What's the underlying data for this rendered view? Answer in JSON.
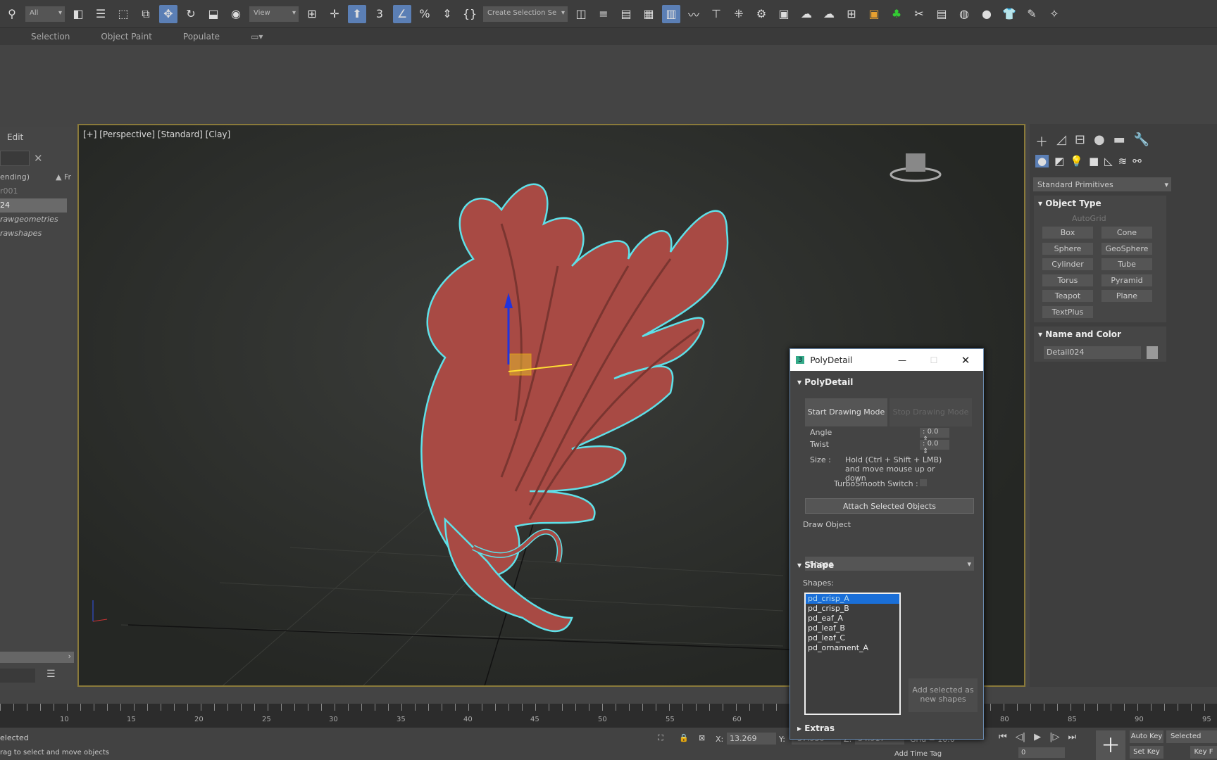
{
  "toolbar": {
    "selection_filter": "All",
    "ref_coord": "View",
    "named_selection": "Create Selection Se"
  },
  "ribbon_tabs": [
    "Selection",
    "Object Paint",
    "Populate"
  ],
  "left_panel": {
    "menu": "Edit",
    "sort_label": "ending)",
    "col_label": "▲ Fr",
    "items": [
      "r001",
      "24",
      "rawgeometries",
      "rawshapes"
    ]
  },
  "viewport": {
    "label": "[+] [Perspective] [Standard] [Clay]",
    "accent": "#8a7a3a",
    "object_color": "#a84a44",
    "outline_color": "#5fe0e8"
  },
  "command_panel": {
    "category": "Standard Primitives",
    "object_type_title": "Object Type",
    "autogrid": "AutoGrid",
    "buttons": [
      "Box",
      "Cone",
      "Sphere",
      "GeoSphere",
      "Cylinder",
      "Tube",
      "Torus",
      "Pyramid",
      "Teapot",
      "Plane",
      "TextPlus"
    ],
    "name_color_title": "Name and Color",
    "object_name": "Detail024"
  },
  "polydetail": {
    "window_title": "PolyDetail",
    "rollout_title": "PolyDetail",
    "start_btn": "Start Drawing Mode",
    "stop_btn": "Stop Drawing Mode",
    "angle_label": "Angle",
    "angle_value": "0.0",
    "twist_label": "Twist",
    "twist_value": "0.0",
    "size_label": "Size :",
    "size_hint": "Hold (Ctrl + Shift + LMB) and move mouse up or down",
    "turbosmooth_label": "TurboSmooth Switch :",
    "attach_btn": "Attach Selected Objects",
    "draw_object_label": "Draw Object",
    "draw_object_value": "Shape",
    "shape_title": "Shape",
    "shapes_label": "Shapes:",
    "shapes": [
      "pd_crisp_A",
      "pd_crisp_B",
      "pd_eaf_A",
      "pd_leaf_B",
      "pd_leaf_C",
      "pd_ornament_A"
    ],
    "selected_shape": "pd_crisp_A",
    "add_btn": "Add selected as new shapes",
    "extras_title": "Extras"
  },
  "timeline": {
    "ticks": [
      "10",
      "15",
      "20",
      "25",
      "30",
      "35",
      "40",
      "45",
      "50",
      "55",
      "60",
      "80",
      "85",
      "90",
      "95"
    ]
  },
  "status": {
    "selected_text": "elected",
    "hint": "rag to select and move objects",
    "x_label": "X:",
    "x_value": "13.269",
    "y_label": "Y:",
    "y_value": "-37.930",
    "z_label": "Z:",
    "z_value": "34.917",
    "grid": "Grid = 10.0",
    "add_time_tag": "Add Time Tag",
    "frame": "0",
    "auto_key": "Auto Key",
    "selected": "Selected",
    "set_key": "Set Key",
    "key_filters": "Key F"
  }
}
